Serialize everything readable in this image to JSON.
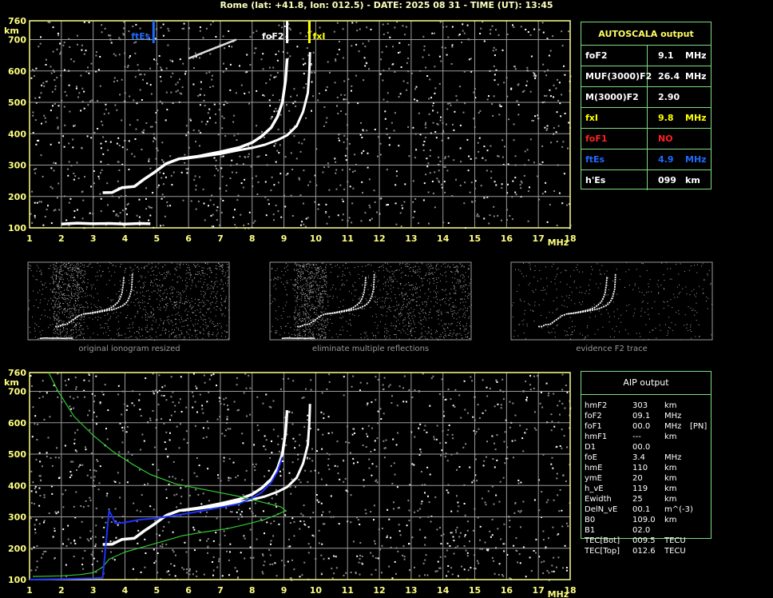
{
  "header": "Rome (lat: +41.8, lon: 012.5) - DATE: 2025 08 31 - TIME (UT): 13:45",
  "colors": {
    "grid": "#9a9a9a",
    "frame": "#ffff90",
    "fxI": "#ffff00",
    "ftEs": "#1e6bff",
    "foF1": "#ff2020",
    "border": "#7fdc7f",
    "profile_green": "#32c832",
    "profile_blue": "#1e32ff"
  },
  "chart_data": [
    {
      "type": "line",
      "title": "",
      "xlabel": "MHz",
      "ylabel": "km",
      "xlim": [
        1,
        18
      ],
      "ylim": [
        100,
        760
      ],
      "x_ticks": [
        1,
        2,
        3,
        4,
        5,
        6,
        7,
        8,
        9,
        10,
        11,
        12,
        13,
        14,
        15,
        16,
        17,
        18
      ],
      "y_ticks": [
        100,
        200,
        300,
        400,
        500,
        600,
        700,
        760
      ],
      "grid": true,
      "markers": [
        {
          "name": "ftEs",
          "x": 4.9,
          "color": "#1e6bff"
        },
        {
          "name": "foF2",
          "x": 9.1,
          "color": "#ffffff"
        },
        {
          "name": "fxI",
          "x": 9.8,
          "color": "#ffff00"
        }
      ],
      "series": [
        {
          "values": [
            [
              3.3,
              212
            ],
            [
              3.6,
              213
            ],
            [
              3.9,
              228
            ],
            [
              4.3,
              232
            ],
            [
              4.6,
              255
            ],
            [
              4.9,
              275
            ],
            [
              5.3,
              305
            ],
            [
              5.7,
              320
            ],
            [
              6.3,
              328
            ],
            [
              7.0,
              342
            ],
            [
              7.6,
              356
            ],
            [
              8.0,
              372
            ],
            [
              8.3,
              392
            ],
            [
              8.6,
              420
            ],
            [
              8.8,
              455
            ],
            [
              8.95,
              500
            ],
            [
              9.05,
              570
            ],
            [
              9.1,
              640
            ]
          ]
        },
        {
          "values": [
            [
              5.8,
              320
            ],
            [
              6.3,
              326
            ],
            [
              7.0,
              336
            ],
            [
              7.6,
              348
            ],
            [
              8.0,
              355
            ],
            [
              8.4,
              365
            ],
            [
              8.8,
              380
            ],
            [
              9.1,
              395
            ],
            [
              9.4,
              425
            ],
            [
              9.6,
              470
            ],
            [
              9.75,
              530
            ],
            [
              9.8,
              600
            ],
            [
              9.82,
              660
            ]
          ]
        },
        {
          "values": [
            [
              2.0,
              112
            ],
            [
              2.5,
              115
            ],
            [
              3.0,
              113
            ],
            [
              3.5,
              114
            ],
            [
              4.0,
              112
            ],
            [
              4.5,
              114
            ],
            [
              4.8,
              113
            ]
          ]
        },
        {
          "values": [
            [
              6.0,
              640
            ],
            [
              6.5,
              660
            ],
            [
              7.0,
              680
            ],
            [
              7.5,
              700
            ]
          ]
        }
      ]
    },
    {
      "type": "line",
      "title": "",
      "xlabel": "MHz",
      "ylabel": "km",
      "xlim": [
        1,
        18
      ],
      "ylim": [
        100,
        760
      ],
      "x_ticks": [
        1,
        2,
        3,
        4,
        5,
        6,
        7,
        8,
        9,
        10,
        11,
        12,
        13,
        14,
        15,
        16,
        17,
        18
      ],
      "y_ticks": [
        100,
        200,
        300,
        400,
        500,
        600,
        700,
        760
      ],
      "grid": true,
      "series": [
        {
          "values": [
            [
              3.3,
              212
            ],
            [
              3.6,
              213
            ],
            [
              3.9,
              228
            ],
            [
              4.3,
              232
            ],
            [
              4.6,
              255
            ],
            [
              4.9,
              275
            ],
            [
              5.3,
              305
            ],
            [
              5.7,
              320
            ],
            [
              6.3,
              328
            ],
            [
              7.0,
              342
            ],
            [
              7.6,
              356
            ],
            [
              8.0,
              372
            ],
            [
              8.3,
              392
            ],
            [
              8.6,
              420
            ],
            [
              8.8,
              455
            ],
            [
              8.95,
              500
            ],
            [
              9.05,
              570
            ],
            [
              9.1,
              640
            ]
          ]
        },
        {
          "values": [
            [
              5.8,
              320
            ],
            [
              6.3,
              326
            ],
            [
              7.0,
              336
            ],
            [
              7.6,
              348
            ],
            [
              8.0,
              355
            ],
            [
              8.4,
              365
            ],
            [
              8.8,
              380
            ],
            [
              9.1,
              395
            ],
            [
              9.4,
              425
            ],
            [
              9.6,
              470
            ],
            [
              9.75,
              530
            ],
            [
              9.8,
              600
            ],
            [
              9.82,
              660
            ]
          ]
        },
        {
          "values": [
            [
              1.1,
              110
            ],
            [
              2.0,
              112
            ],
            [
              2.6,
              116
            ],
            [
              3.0,
              122
            ],
            [
              3.3,
              140
            ],
            [
              3.5,
              165
            ],
            [
              4.0,
              188
            ],
            [
              4.6,
              205
            ],
            [
              5.2,
              222
            ],
            [
              5.8,
              240
            ],
            [
              6.5,
              252
            ],
            [
              7.2,
              262
            ],
            [
              7.8,
              276
            ],
            [
              8.4,
              292
            ],
            [
              8.8,
              308
            ],
            [
              9.05,
              320
            ],
            [
              8.9,
              332
            ],
            [
              8.4,
              345
            ],
            [
              7.6,
              365
            ],
            [
              6.6,
              385
            ],
            [
              5.6,
              405
            ],
            [
              4.8,
              435
            ],
            [
              4.2,
              470
            ],
            [
              3.6,
              510
            ],
            [
              3.0,
              560
            ],
            [
              2.4,
              620
            ],
            [
              1.9,
              700
            ],
            [
              1.6,
              760
            ]
          ]
        },
        {
          "values": [
            [
              1.0,
              100
            ],
            [
              2.0,
              102
            ],
            [
              3.0,
              104
            ],
            [
              3.3,
              106
            ],
            [
              3.5,
              320
            ],
            [
              3.7,
              280
            ],
            [
              4.0,
              282
            ],
            [
              4.4,
              290
            ],
            [
              5.0,
              296
            ],
            [
              5.6,
              305
            ],
            [
              6.2,
              315
            ],
            [
              7.0,
              330
            ],
            [
              7.6,
              342
            ],
            [
              8.0,
              360
            ],
            [
              8.3,
              378
            ],
            [
              8.6,
              410
            ],
            [
              8.8,
              445
            ],
            [
              8.95,
              490
            ]
          ]
        }
      ]
    }
  ],
  "thumbnails": [
    {
      "caption": "original ionogram resized"
    },
    {
      "caption": "eliminate multiple reflections"
    },
    {
      "caption": "evidence F2 trace"
    }
  ],
  "autoscala": {
    "title": "AUTOSCALA output",
    "rows": [
      {
        "label": "foF2",
        "value": "9.1",
        "unit": "MHz",
        "color": "#ffffff"
      },
      {
        "label": "MUF(3000)F2",
        "value": "26.4",
        "unit": "MHz",
        "color": "#ffffff"
      },
      {
        "label": "M(3000)F2",
        "value": "2.90",
        "unit": "",
        "color": "#ffffff"
      },
      {
        "label": "fxI",
        "value": "9.8",
        "unit": "MHz",
        "color": "#ffff00"
      },
      {
        "label": "foF1",
        "value": "NO",
        "unit": "",
        "color": "#ff2020"
      },
      {
        "label": "ftEs",
        "value": "4.9",
        "unit": "MHz",
        "color": "#1e6bff"
      },
      {
        "label": "h'Es",
        "value": "099",
        "unit": "km",
        "color": "#ffffff"
      }
    ]
  },
  "aip": {
    "title": "AIP output",
    "rows": [
      {
        "label": "hmF2",
        "value": "303",
        "unit": "km",
        "extra": ""
      },
      {
        "label": "foF2",
        "value": "09.1",
        "unit": "MHz",
        "extra": ""
      },
      {
        "label": "foF1",
        "value": "00.0",
        "unit": "MHz",
        "extra": "[PN]"
      },
      {
        "label": "hmF1",
        "value": "---",
        "unit": "km",
        "extra": ""
      },
      {
        "label": "D1",
        "value": "00.0",
        "unit": "",
        "extra": ""
      },
      {
        "label": "foE",
        "value": "3.4",
        "unit": "MHz",
        "extra": ""
      },
      {
        "label": "hmE",
        "value": "110",
        "unit": "km",
        "extra": ""
      },
      {
        "label": "ymE",
        "value": "20",
        "unit": "km",
        "extra": ""
      },
      {
        "label": "h_vE",
        "value": "119",
        "unit": "km",
        "extra": ""
      },
      {
        "label": "Ewidth",
        "value": "25",
        "unit": "km",
        "extra": ""
      },
      {
        "label": "DelN_vE",
        "value": "00.1",
        "unit": "m^(-3)",
        "extra": ""
      },
      {
        "label": "B0",
        "value": "109.0",
        "unit": "km",
        "extra": ""
      },
      {
        "label": "B1",
        "value": "02.0",
        "unit": "",
        "extra": ""
      },
      {
        "label": "TEC[Bot]",
        "value": "009.5",
        "unit": "TECU",
        "extra": ""
      },
      {
        "label": "TEC[Top]",
        "value": "012.6",
        "unit": "TECU",
        "extra": ""
      }
    ]
  }
}
